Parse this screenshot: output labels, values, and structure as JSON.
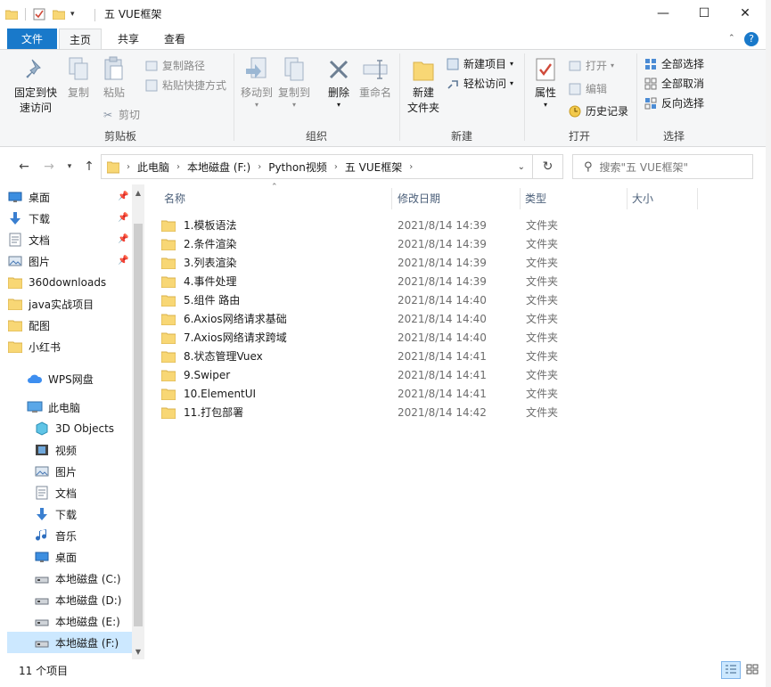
{
  "window": {
    "title": "五 VUE框架",
    "controls": {
      "minimize": "—",
      "maximize": "☐",
      "close": "✕"
    }
  },
  "ribbon_tabs": [
    {
      "label": "文件"
    },
    {
      "label": "主页"
    },
    {
      "label": "共享"
    },
    {
      "label": "查看"
    }
  ],
  "ribbon": {
    "clipboard": {
      "group_label": "剪贴板",
      "pin_quick_access_l1": "固定到快",
      "pin_quick_access_l2": "速访问",
      "copy": "复制",
      "paste": "粘贴",
      "copy_path": "复制路径",
      "paste_shortcut": "粘贴快捷方式",
      "cut": "剪切"
    },
    "organize": {
      "group_label": "组织",
      "move_to": "移动到",
      "copy_to": "复制到",
      "delete": "删除",
      "rename": "重命名"
    },
    "new": {
      "group_label": "新建",
      "new_folder_l1": "新建",
      "new_folder_l2": "文件夹",
      "new_item": "新建项目",
      "easy_access": "轻松访问"
    },
    "open": {
      "group_label": "打开",
      "properties": "属性",
      "open": "打开",
      "edit": "编辑",
      "history": "历史记录"
    },
    "select": {
      "group_label": "选择",
      "select_all": "全部选择",
      "select_none": "全部取消",
      "invert": "反向选择"
    }
  },
  "address": {
    "crumbs": [
      "此电脑",
      "本地磁盘 (F:)",
      "Python视频",
      "五 VUE框架"
    ],
    "search_placeholder": "搜索\"五 VUE框架\""
  },
  "nav_pane": {
    "quick_access": [
      {
        "label": "桌面",
        "icon": "desktop-icon",
        "pinned": true
      },
      {
        "label": "下载",
        "icon": "download-icon",
        "pinned": true
      },
      {
        "label": "文档",
        "icon": "document-icon",
        "pinned": true
      },
      {
        "label": "图片",
        "icon": "picture-icon",
        "pinned": true
      },
      {
        "label": "360downloads",
        "icon": "folder-icon",
        "pinned": false
      },
      {
        "label": "java实战项目",
        "icon": "folder-icon",
        "pinned": false
      },
      {
        "label": "配图",
        "icon": "folder-icon",
        "pinned": false
      },
      {
        "label": "小红书",
        "icon": "folder-icon",
        "pinned": false
      }
    ],
    "wps": "WPS网盘",
    "this_pc": "此电脑",
    "pc_items": [
      {
        "label": "3D Objects",
        "icon": "3d-objects-icon"
      },
      {
        "label": "视频",
        "icon": "video-icon"
      },
      {
        "label": "图片",
        "icon": "picture-icon"
      },
      {
        "label": "文档",
        "icon": "document-icon"
      },
      {
        "label": "下载",
        "icon": "download-icon"
      },
      {
        "label": "音乐",
        "icon": "music-icon"
      },
      {
        "label": "桌面",
        "icon": "desktop-icon"
      },
      {
        "label": "本地磁盘 (C:)",
        "icon": "drive-icon"
      },
      {
        "label": "本地磁盘 (D:)",
        "icon": "drive-icon"
      },
      {
        "label": "本地磁盘 (E:)",
        "icon": "drive-icon"
      },
      {
        "label": "本地磁盘 (F:)",
        "icon": "drive-icon",
        "selected": true
      }
    ]
  },
  "file_list": {
    "columns": [
      "名称",
      "修改日期",
      "类型",
      "大小"
    ],
    "files": [
      {
        "name": "1.模板语法",
        "date": "2021/8/14 14:39",
        "type": "文件夹"
      },
      {
        "name": "2.条件渲染",
        "date": "2021/8/14 14:39",
        "type": "文件夹"
      },
      {
        "name": "3.列表渲染",
        "date": "2021/8/14 14:39",
        "type": "文件夹"
      },
      {
        "name": "4.事件处理",
        "date": "2021/8/14 14:39",
        "type": "文件夹"
      },
      {
        "name": "5.组件  路由",
        "date": "2021/8/14 14:40",
        "type": "文件夹"
      },
      {
        "name": "6.Axios网络请求基础",
        "date": "2021/8/14 14:40",
        "type": "文件夹"
      },
      {
        "name": "7.Axios网络请求跨域",
        "date": "2021/8/14 14:40",
        "type": "文件夹"
      },
      {
        "name": "8.状态管理Vuex",
        "date": "2021/8/14 14:41",
        "type": "文件夹"
      },
      {
        "name": "9.Swiper",
        "date": "2021/8/14 14:41",
        "type": "文件夹"
      },
      {
        "name": "10.ElementUI",
        "date": "2021/8/14 14:41",
        "type": "文件夹"
      },
      {
        "name": "11.打包部署",
        "date": "2021/8/14 14:42",
        "type": "文件夹"
      }
    ]
  },
  "status": {
    "item_count": "11 个项目"
  },
  "colors": {
    "accent": "#1979ca",
    "folder": "#f8d775",
    "selection": "#cce8ff"
  }
}
